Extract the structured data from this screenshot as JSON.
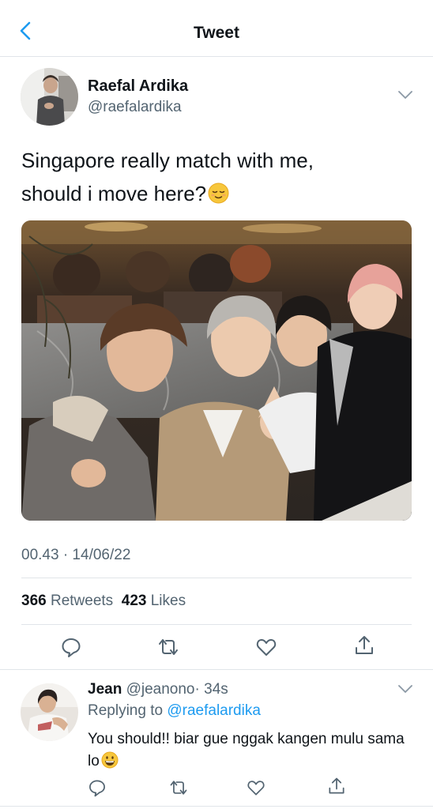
{
  "header": {
    "title": "Tweet"
  },
  "tweet": {
    "author_name": "Raefal Ardika",
    "author_handle": "@raefalardika",
    "text_line1": "Singapore really match with me,",
    "text_line2": "should i move here?",
    "emoji": "relieved-face",
    "timestamp": "00.43 · 14/06/22",
    "retweets_count": "366",
    "retweets_label": "Retweets",
    "likes_count": "423",
    "likes_label": "Likes"
  },
  "reply": {
    "author_name": "Jean",
    "author_handle": "@jeanono",
    "time": "· 34s",
    "replying_prefix": "Replying to",
    "replying_to": "@raefalardika",
    "text": "You should!! biar gue nggak kangen mulu sama lo",
    "emoji": "grinning-face"
  },
  "colors": {
    "accent": "#1d9bf0",
    "muted": "#536471",
    "divider": "#e1e5e9"
  }
}
